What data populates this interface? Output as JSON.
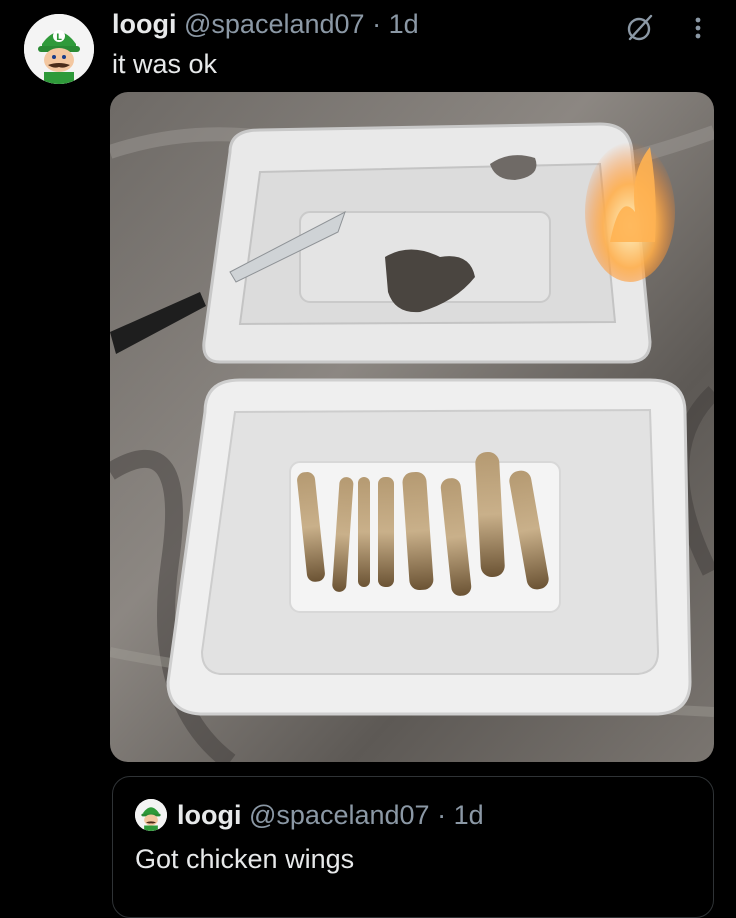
{
  "post": {
    "author_name": "loogi",
    "author_handle": "@spaceland07",
    "separator": "·",
    "time": "1d",
    "text": "it was ok"
  },
  "icons": {
    "avatar": "luigi-avatar",
    "grok": "grok-icon",
    "more": "more-options-icon"
  },
  "media": {
    "photo_description_icon": "photo"
  },
  "quoted_post": {
    "author_name": "loogi",
    "author_handle": "@spaceland07",
    "separator": "·",
    "time": "1d",
    "text": "Got chicken wings"
  },
  "colors": {
    "background": "#000000",
    "text_primary": "#e7e9ea",
    "text_secondary": "#8b98a5",
    "border": "#2f3336"
  }
}
